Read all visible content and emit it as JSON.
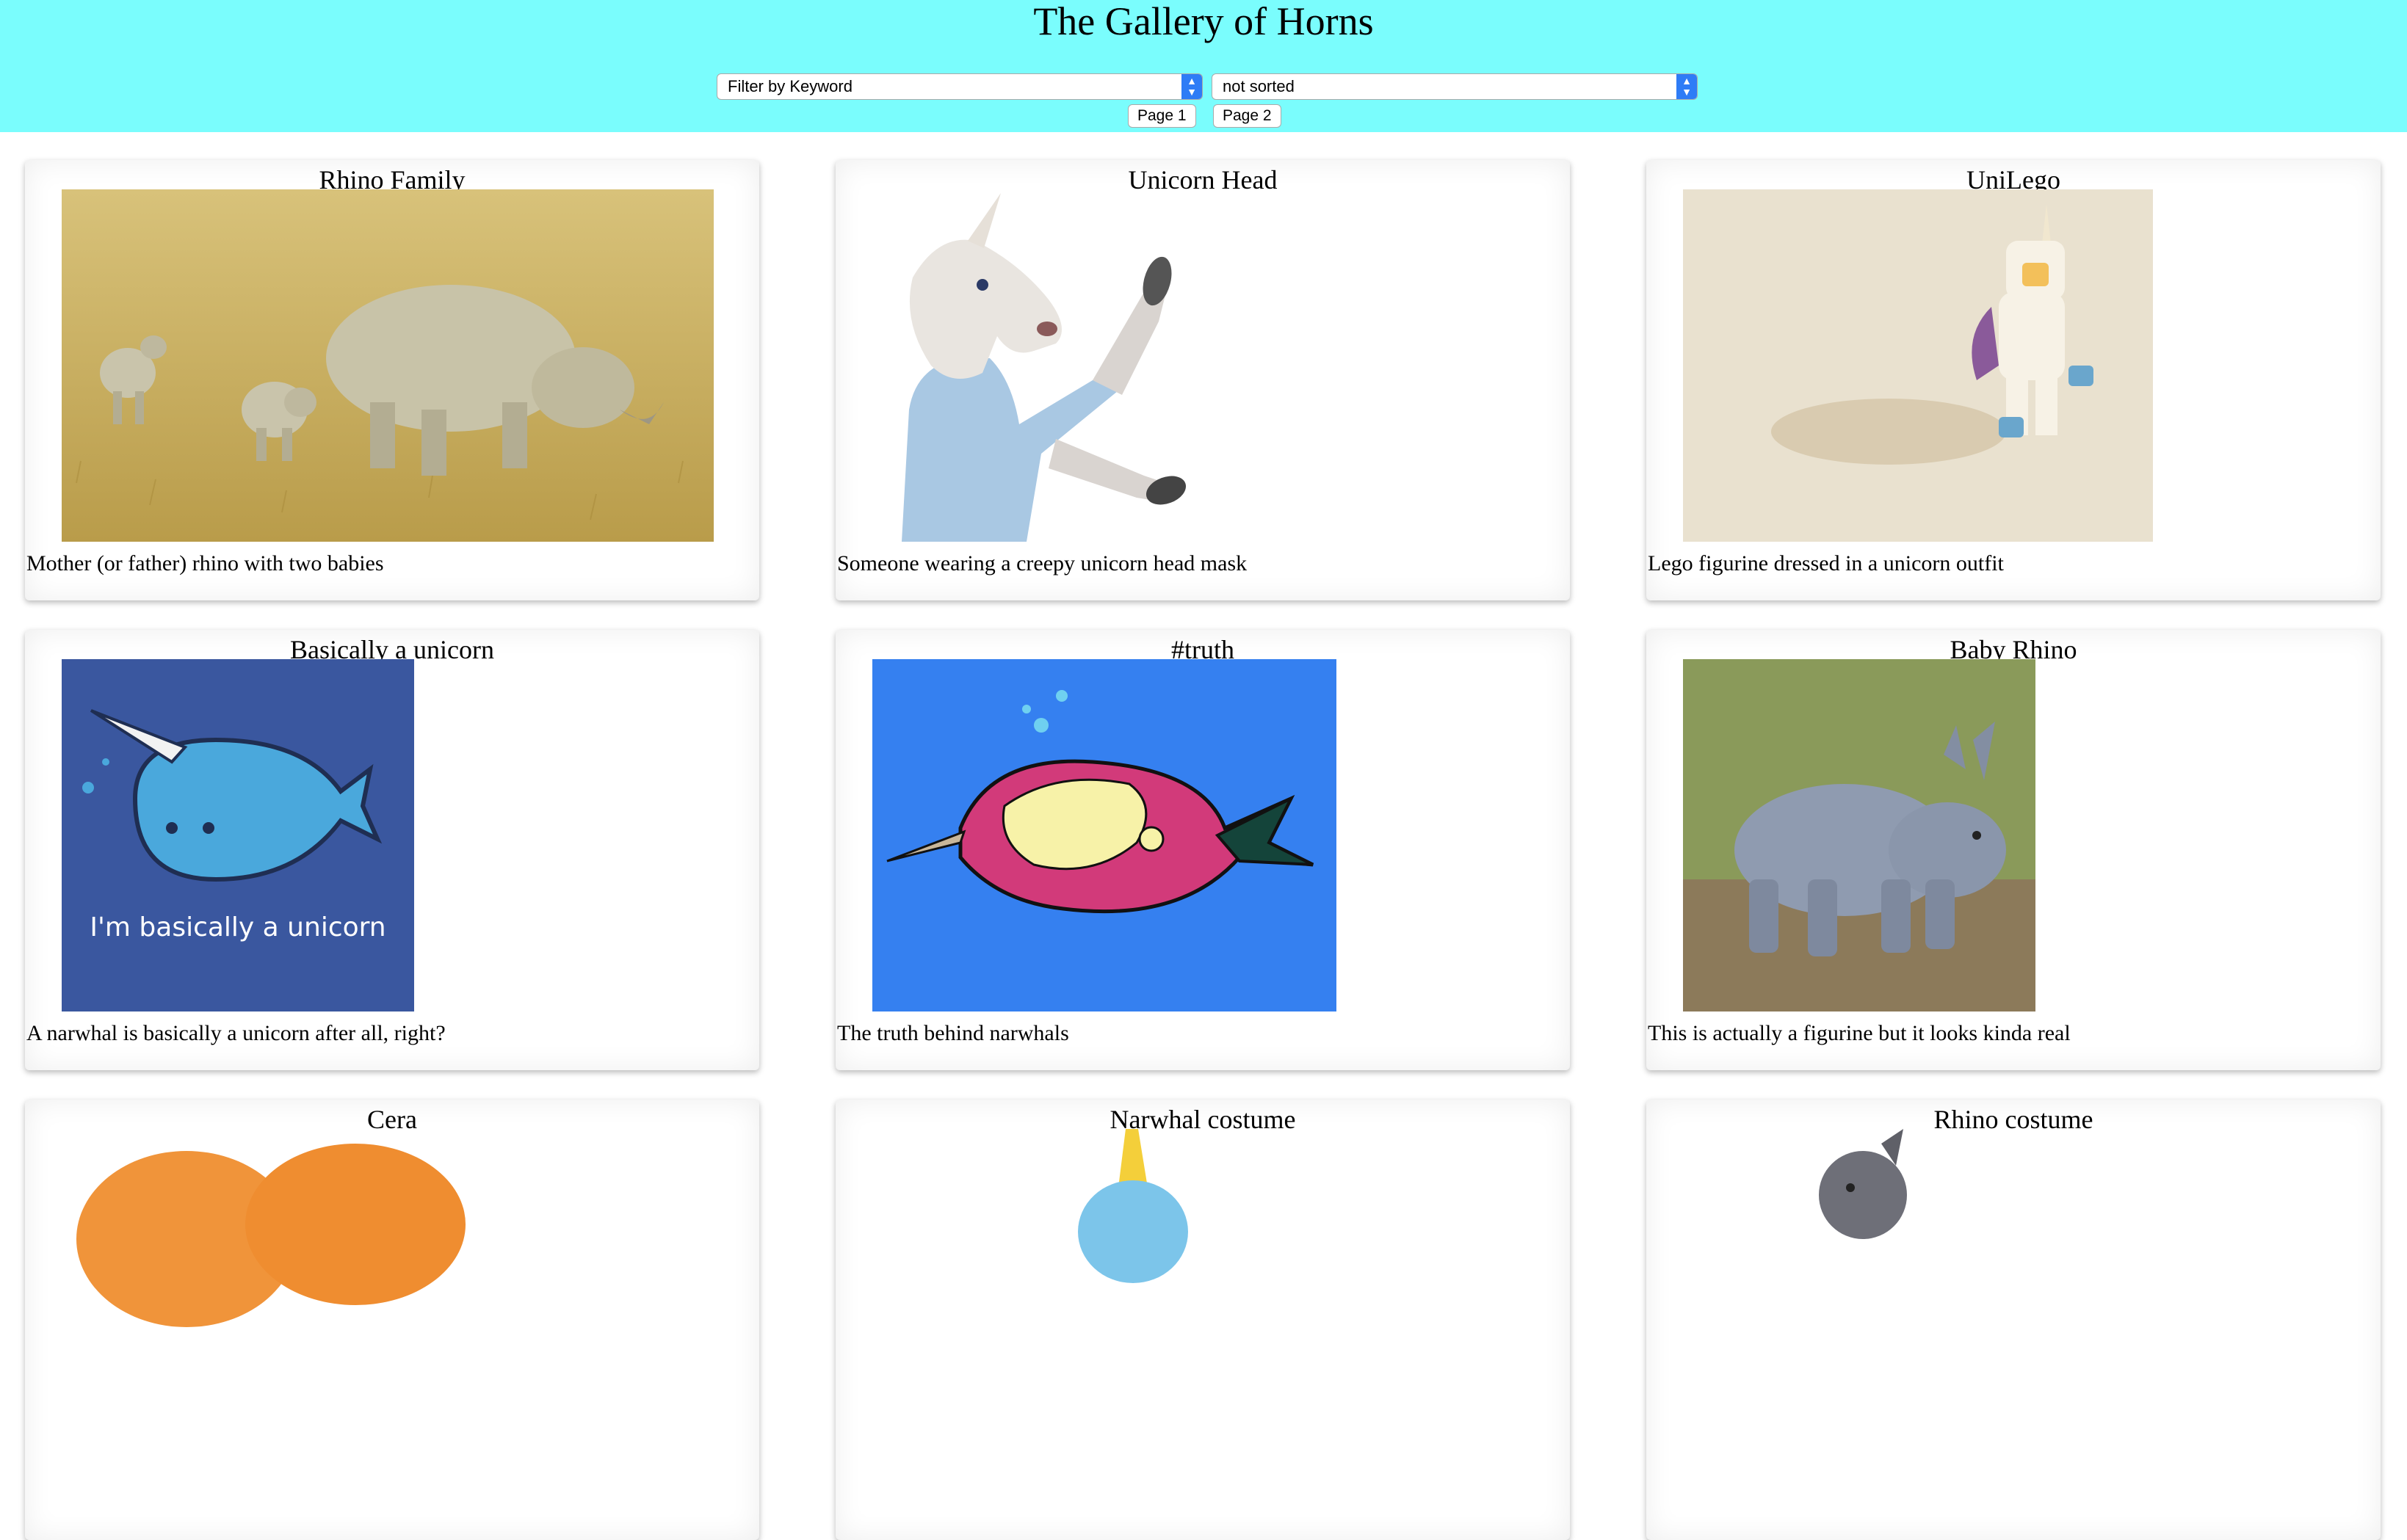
{
  "header": {
    "title": "The Gallery of Horns",
    "keyword_filter": "Filter by Keyword",
    "sort_select": "not sorted",
    "page1": "Page 1",
    "page2": "Page 2"
  },
  "colors": {
    "header_bg": "#7afdfd",
    "accent": "#2e7cf6"
  },
  "cards": [
    {
      "title": "Rhino Family",
      "description": "Mother (or father) rhino with two babies"
    },
    {
      "title": "Unicorn Head",
      "description": "Someone wearing a creepy unicorn head mask"
    },
    {
      "title": "UniLego",
      "description": "Lego figurine dressed in a unicorn outfit"
    },
    {
      "title": "Basically a unicorn",
      "description": "A narwhal is basically a unicorn after all, right?",
      "image_text": "I'm basically a unicorn"
    },
    {
      "title": "#truth",
      "description": "The truth behind narwhals"
    },
    {
      "title": "Baby Rhino",
      "description": "This is actually a figurine but it looks kinda real"
    },
    {
      "title": "Cera",
      "description": ""
    },
    {
      "title": "Narwhal costume",
      "description": ""
    },
    {
      "title": "Rhino costume",
      "description": ""
    }
  ]
}
